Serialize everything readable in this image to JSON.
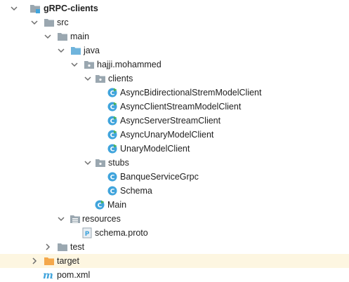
{
  "tree": {
    "root": {
      "label": "gRPC-clients",
      "expanded": true
    },
    "src": {
      "label": "src",
      "expanded": true
    },
    "main": {
      "label": "main",
      "expanded": true
    },
    "java": {
      "label": "java",
      "expanded": true
    },
    "package": {
      "label": "hajji.mohammed",
      "expanded": true
    },
    "clients_pkg": {
      "label": "clients",
      "expanded": true,
      "items": [
        "AsyncBidirectionalStremModelClient",
        "AsyncClientStreamModelClient",
        "AsyncServerStreamClient",
        "AsyncUnaryModelClient",
        "UnaryModelClient"
      ]
    },
    "stubs_pkg": {
      "label": "stubs",
      "expanded": true,
      "items": [
        "BanqueServiceGrpc",
        "Schema"
      ]
    },
    "main_class": {
      "label": "Main"
    },
    "resources": {
      "label": "resources",
      "expanded": true
    },
    "proto_file": {
      "label": "schema.proto"
    },
    "test": {
      "label": "test",
      "expanded": false
    },
    "target": {
      "label": "target",
      "expanded": false
    },
    "pom": {
      "label": "pom.xml"
    }
  },
  "colors": {
    "folder_gray": "#9aa7b0",
    "folder_blue": "#6fb4dc",
    "folder_orange": "#f4a84b",
    "class_blue": "#40a4dc",
    "run_green": "#49b35c",
    "highlight_row": "#fdf6e1"
  }
}
